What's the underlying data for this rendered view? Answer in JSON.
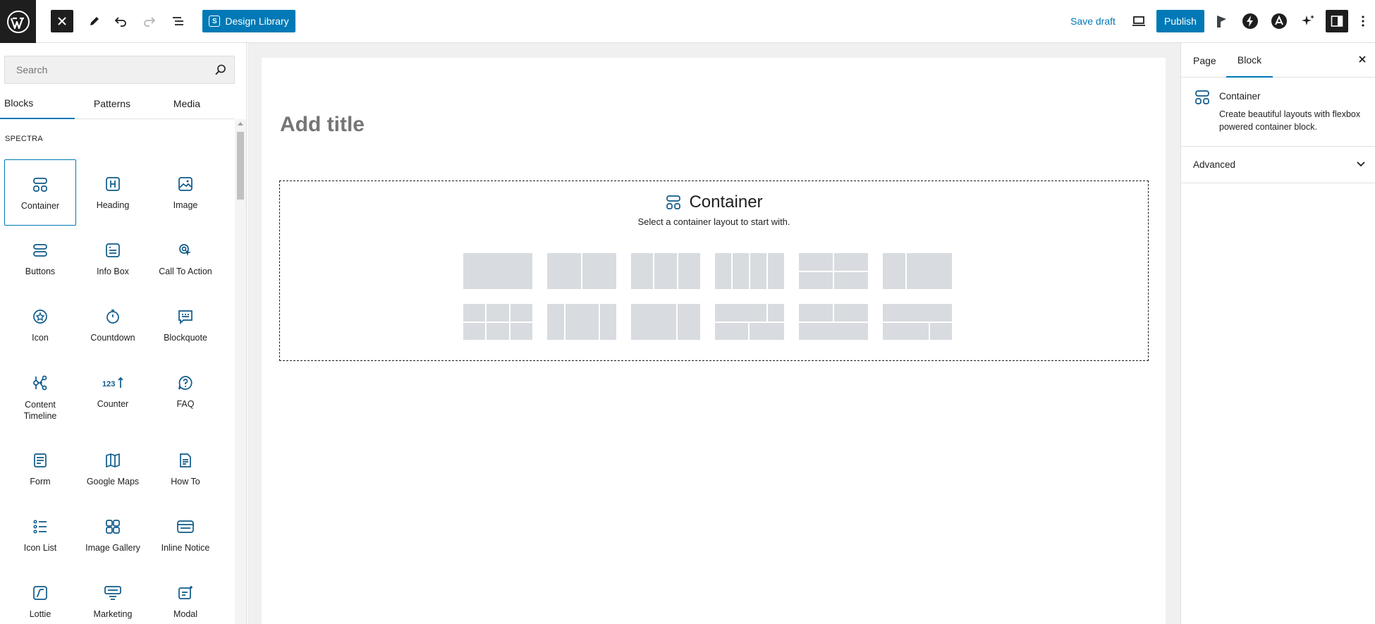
{
  "topbar": {
    "design_library_label": "Design Library",
    "design_library_badge": "S",
    "save_draft_label": "Save draft",
    "publish_label": "Publish"
  },
  "inserter": {
    "search_placeholder": "Search",
    "tabs": [
      {
        "label": "Blocks",
        "active": true
      },
      {
        "label": "Patterns",
        "active": false
      },
      {
        "label": "Media",
        "active": false
      }
    ],
    "category": "SPECTRA",
    "blocks": [
      {
        "label": "Container",
        "icon": "container-icon",
        "selected": true
      },
      {
        "label": "Heading",
        "icon": "heading-icon"
      },
      {
        "label": "Image",
        "icon": "image-icon"
      },
      {
        "label": "Buttons",
        "icon": "buttons-icon"
      },
      {
        "label": "Info Box",
        "icon": "info-box-icon"
      },
      {
        "label": "Call To Action",
        "icon": "call-to-action-icon"
      },
      {
        "label": "Icon",
        "icon": "icon-block-icon"
      },
      {
        "label": "Countdown",
        "icon": "countdown-icon"
      },
      {
        "label": "Blockquote",
        "icon": "blockquote-icon"
      },
      {
        "label": "Content Timeline",
        "icon": "content-timeline-icon"
      },
      {
        "label": "Counter",
        "icon": "counter-icon"
      },
      {
        "label": "FAQ",
        "icon": "faq-icon"
      },
      {
        "label": "Form",
        "icon": "form-icon"
      },
      {
        "label": "Google Maps",
        "icon": "google-maps-icon"
      },
      {
        "label": "How To",
        "icon": "how-to-icon"
      },
      {
        "label": "Icon List",
        "icon": "icon-list-icon"
      },
      {
        "label": "Image Gallery",
        "icon": "image-gallery-icon"
      },
      {
        "label": "Inline Notice",
        "icon": "inline-notice-icon"
      },
      {
        "label": "Lottie",
        "icon": "lottie-icon"
      },
      {
        "label": "Marketing",
        "icon": "marketing-icon"
      },
      {
        "label": "Modal",
        "icon": "modal-icon"
      }
    ]
  },
  "editor": {
    "title_placeholder": "Add title",
    "container_heading": "Container",
    "container_subtitle": "Select a container layout to start with."
  },
  "sidebar": {
    "tabs": [
      {
        "label": "Page",
        "active": false
      },
      {
        "label": "Block",
        "active": true
      }
    ],
    "block_name": "Container",
    "block_description": "Create beautiful layouts with flexbox powered container block.",
    "advanced_label": "Advanced"
  },
  "colors": {
    "accent": "#0079b6",
    "dark": "#1e1e1e",
    "layout_placeholder": "#d8dbdf"
  }
}
